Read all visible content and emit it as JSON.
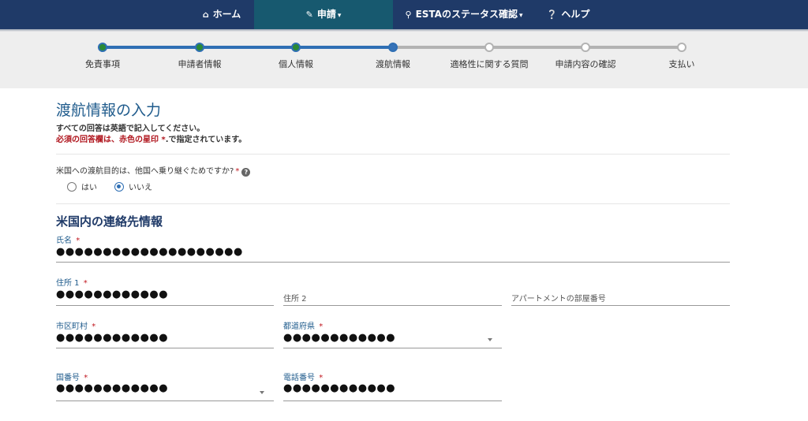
{
  "nav": {
    "home": "ホーム",
    "apply": "申請",
    "status": "ESTAのステータス確認",
    "help": "ヘルプ",
    "icons": {
      "home": "home-icon",
      "apply": "pencil-icon",
      "status": "search-icon",
      "help": "question-circle-icon"
    },
    "colors": {
      "bar": "#1f3a68",
      "active": "#17596f"
    }
  },
  "progress": {
    "steps": [
      {
        "label": "免責事項",
        "state": "done"
      },
      {
        "label": "申請者情報",
        "state": "done"
      },
      {
        "label": "個人情報",
        "state": "done"
      },
      {
        "label": "渡航情報",
        "state": "current"
      },
      {
        "label": "適格性に関する質問",
        "state": "todo"
      },
      {
        "label": "申請内容の確認",
        "state": "todo"
      },
      {
        "label": "支払い",
        "state": "todo"
      }
    ]
  },
  "page": {
    "title": "渡航情報の入力",
    "note_english": "すべての回答は英語で記入してください。",
    "note_required_red": "必須の回答欄は、赤色の星印 *",
    "note_required_rest": ".で指定されています。"
  },
  "transit": {
    "question": "米国への渡航目的は、他国へ乗り継ぐためですか?",
    "required_mark": "*",
    "help_glyph": "?",
    "options": {
      "yes": "はい",
      "no": "いいえ"
    },
    "selected": "いいえ"
  },
  "contact": {
    "section_title": "米国内の連絡先情報",
    "name": {
      "label": "氏名",
      "value": "●●●●●●●●●●●●●●●●●●●●"
    },
    "address1": {
      "label": "住所 1",
      "value": "●●●●●●●●●●●●"
    },
    "address2": {
      "placeholder": "住所 2"
    },
    "apartment": {
      "placeholder": "アパートメントの部屋番号"
    },
    "city": {
      "label": "市区町村",
      "value": "●●●●●●●●●●●●"
    },
    "state": {
      "label": "都道府県",
      "value": "●●●●●●●●●●●●"
    },
    "country_code": {
      "label": "国番号",
      "value": "●●●●●●●●●●●●"
    },
    "phone": {
      "label": "電話番号",
      "value": "●●●●●●●●●●●●"
    },
    "required_mark": "*"
  }
}
